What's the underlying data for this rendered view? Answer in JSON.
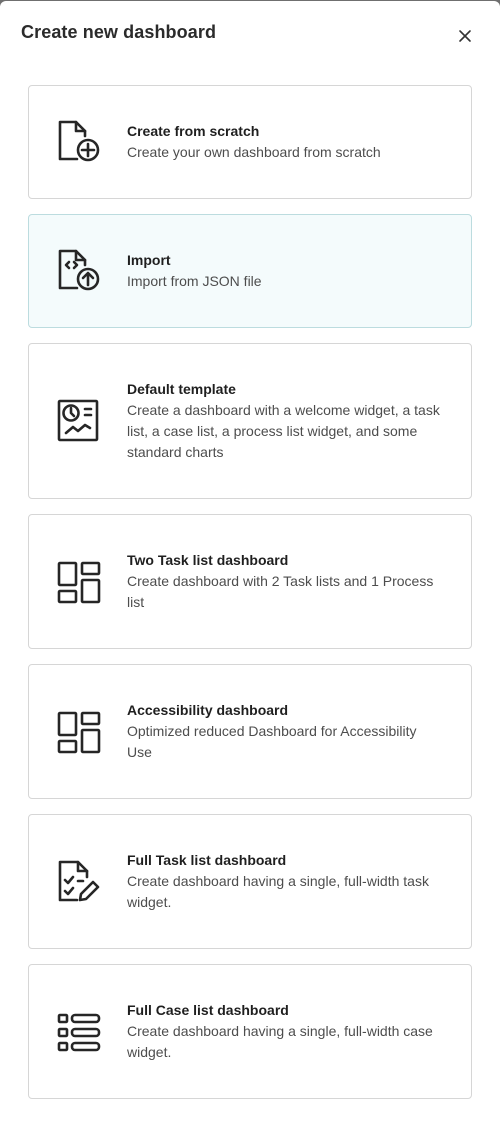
{
  "dialog": {
    "title": "Create new dashboard",
    "close_label": "Close"
  },
  "options": [
    {
      "title": "Create from scratch",
      "description": "Create your own dashboard from scratch",
      "icon": "file-plus-icon",
      "selected": false
    },
    {
      "title": "Import",
      "description": "Import from JSON file",
      "icon": "file-code-upload-icon",
      "selected": true
    },
    {
      "title": "Default template",
      "description": "Create a dashboard with a welcome widget, a task list, a case list, a process list widget, and some standard charts",
      "icon": "template-chart-icon",
      "selected": false
    },
    {
      "title": "Two Task list dashboard",
      "description": "Create dashboard with 2 Task lists and 1 Process list",
      "icon": "layout-grid-icon",
      "selected": false
    },
    {
      "title": "Accessibility dashboard",
      "description": "Optimized reduced Dashboard for Accessibility Use",
      "icon": "layout-grid-icon",
      "selected": false
    },
    {
      "title": "Full Task list dashboard",
      "description": "Create dashboard having a single, full-width task widget.",
      "icon": "file-checklist-edit-icon",
      "selected": false
    },
    {
      "title": "Full Case list dashboard",
      "description": "Create dashboard having a single, full-width case widget.",
      "icon": "list-icon",
      "selected": false
    }
  ],
  "colors": {
    "selected_background": "#f4fbfc",
    "border": "#d6d6d6",
    "title_text": "#1f1f1f",
    "description_text": "#4d4d4d"
  }
}
